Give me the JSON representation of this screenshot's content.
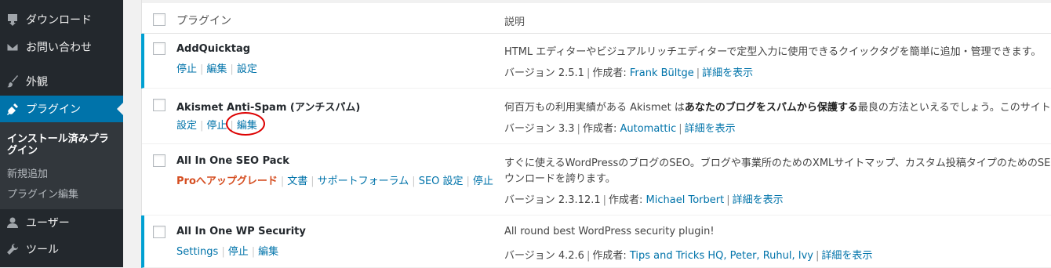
{
  "sidebar": {
    "items": [
      {
        "label": "ダウンロード",
        "icon": "download-icon"
      },
      {
        "label": "お問い合わせ",
        "icon": "mail-icon"
      },
      {
        "label": "外観",
        "icon": "brush-icon"
      },
      {
        "label": "プラグイン",
        "icon": "plugin-icon"
      },
      {
        "label": "ユーザー",
        "icon": "user-icon"
      },
      {
        "label": "ツール",
        "icon": "wrench-icon"
      }
    ],
    "submenu": [
      "インストール済みプラグイン",
      "新規追加",
      "プラグイン編集"
    ]
  },
  "table": {
    "col_plugin": "プラグイン",
    "col_desc": "説明",
    "rows": [
      {
        "name": "AddQuicktag",
        "actions": [
          "停止",
          "編集",
          "設定"
        ],
        "desc": "HTML エディターやビジュアルリッチエディターで定型入力に使用できるクイックタグを簡単に追加・管理できます。",
        "version": "バージョン 2.5.1",
        "author_label": "作成者:",
        "author": "Frank Bültge",
        "details": "詳細を表示"
      },
      {
        "name": "Akismet Anti-Spam (アンチスパム)",
        "actions": [
          "設定",
          "停止",
          "編集"
        ],
        "desc_pre": "何百万もの利用実績がある Akismet は",
        "desc_bold": "あなたのブログをスパムから保護する",
        "desc_post": "最良の方法といえるでしょう。このサイトで",
        "version": "バージョン 3.3",
        "author_label": "作成者:",
        "author": "Automattic",
        "details": "詳細を表示"
      },
      {
        "name": "All In One SEO Pack",
        "actions": [
          "Proへアップグレード",
          "文書",
          "サポートフォーラム",
          "SEO 設定",
          "停止"
        ],
        "desc": "すぐに使えるWordPressのブログのSEO。ブログや事業所のためのXMLサイトマップ、カスタム投稿タイプのためのSEO、",
        "desc2": "ウンロードを誇ります。",
        "version": "バージョン 2.3.12.1",
        "author_label": "作成者:",
        "author": "Michael Torbert",
        "details": "詳細を表示"
      },
      {
        "name": "All In One WP Security",
        "actions": [
          "Settings",
          "停止",
          "編集"
        ],
        "desc": "All round best WordPress security plugin!",
        "version": "バージョン 4.2.6",
        "author_label": "作成者:",
        "author": "Tips and Tricks HQ, Peter, Ruhul, Ivy",
        "details": "詳細を表示"
      }
    ]
  }
}
